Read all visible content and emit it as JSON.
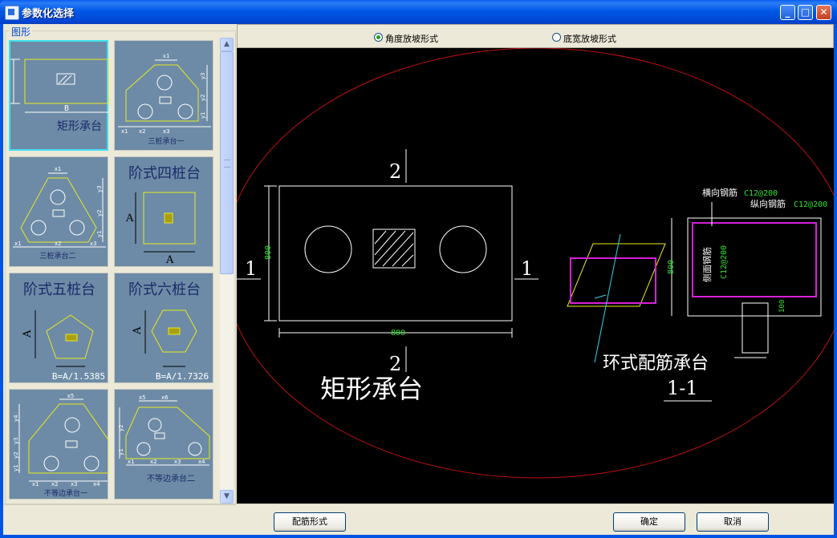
{
  "window": {
    "title": "参数化选择"
  },
  "left": {
    "group_label": "图形",
    "thumbnails": [
      {
        "label": "矩形承台",
        "dim": "B",
        "selected": true
      },
      {
        "label": "三桩承台一",
        "top": "x1",
        "side": [
          "y3",
          "y2",
          "y1"
        ],
        "bottom": [
          "x1",
          "x2",
          "x3"
        ]
      },
      {
        "label": "三桩承台二",
        "top": "x1",
        "side": [
          "y3",
          "y2",
          "y1"
        ],
        "bottom": [
          "x1",
          "x2",
          "x3"
        ]
      },
      {
        "label": "阶式四桩台",
        "dim1": "A",
        "dim2": "A"
      },
      {
        "label": "阶式五桩台",
        "dim": "A",
        "formula": "B=A/1.5385"
      },
      {
        "label": "阶式六桩台",
        "dim": "A",
        "formula": "B=A/1.7326"
      },
      {
        "label": "不等边承台一",
        "top": "x5",
        "side": [
          "y4",
          "y3",
          "y2",
          "y1"
        ],
        "bottom": [
          "x1",
          "x2",
          "x3",
          "x4"
        ]
      },
      {
        "label": "不等边承台二",
        "top": [
          "x5",
          "x6"
        ],
        "side": [
          "y2",
          "y1"
        ],
        "bottom": [
          "x1",
          "x2",
          "x3",
          "x4"
        ]
      }
    ]
  },
  "radios": [
    {
      "label": "角度放坡形式",
      "checked": true
    },
    {
      "label": "底宽放坡形式",
      "checked": false
    }
  ],
  "drawing": {
    "section_top": "2",
    "section_bottom": "2",
    "section_left": "1",
    "section_right": "1",
    "dim_width": "800",
    "dim_height": "800",
    "main_title": "矩形承台",
    "ring_title": "环式配筋承台",
    "section_title": "1-1",
    "section_dim_height": "800",
    "section_dim_cover": "100",
    "rebar_transverse": "横向钢筋",
    "rebar_transverse_spec": "C12@200",
    "rebar_longitudinal": "纵向钢筋",
    "rebar_longitudinal_spec": "C12@200",
    "rebar_side": "侧面钢筋",
    "rebar_side_spec": "C12@200"
  },
  "buttons": {
    "rebar_form": "配筋形式",
    "ok": "确定",
    "cancel": "取消"
  },
  "colors": {
    "canvas": "#000000",
    "ellipse": "#c01010",
    "rebar": "#d81fd8",
    "spec_text": "#30e030",
    "outline_yellow": "#e8e820",
    "cyan": "#30d8e8"
  }
}
